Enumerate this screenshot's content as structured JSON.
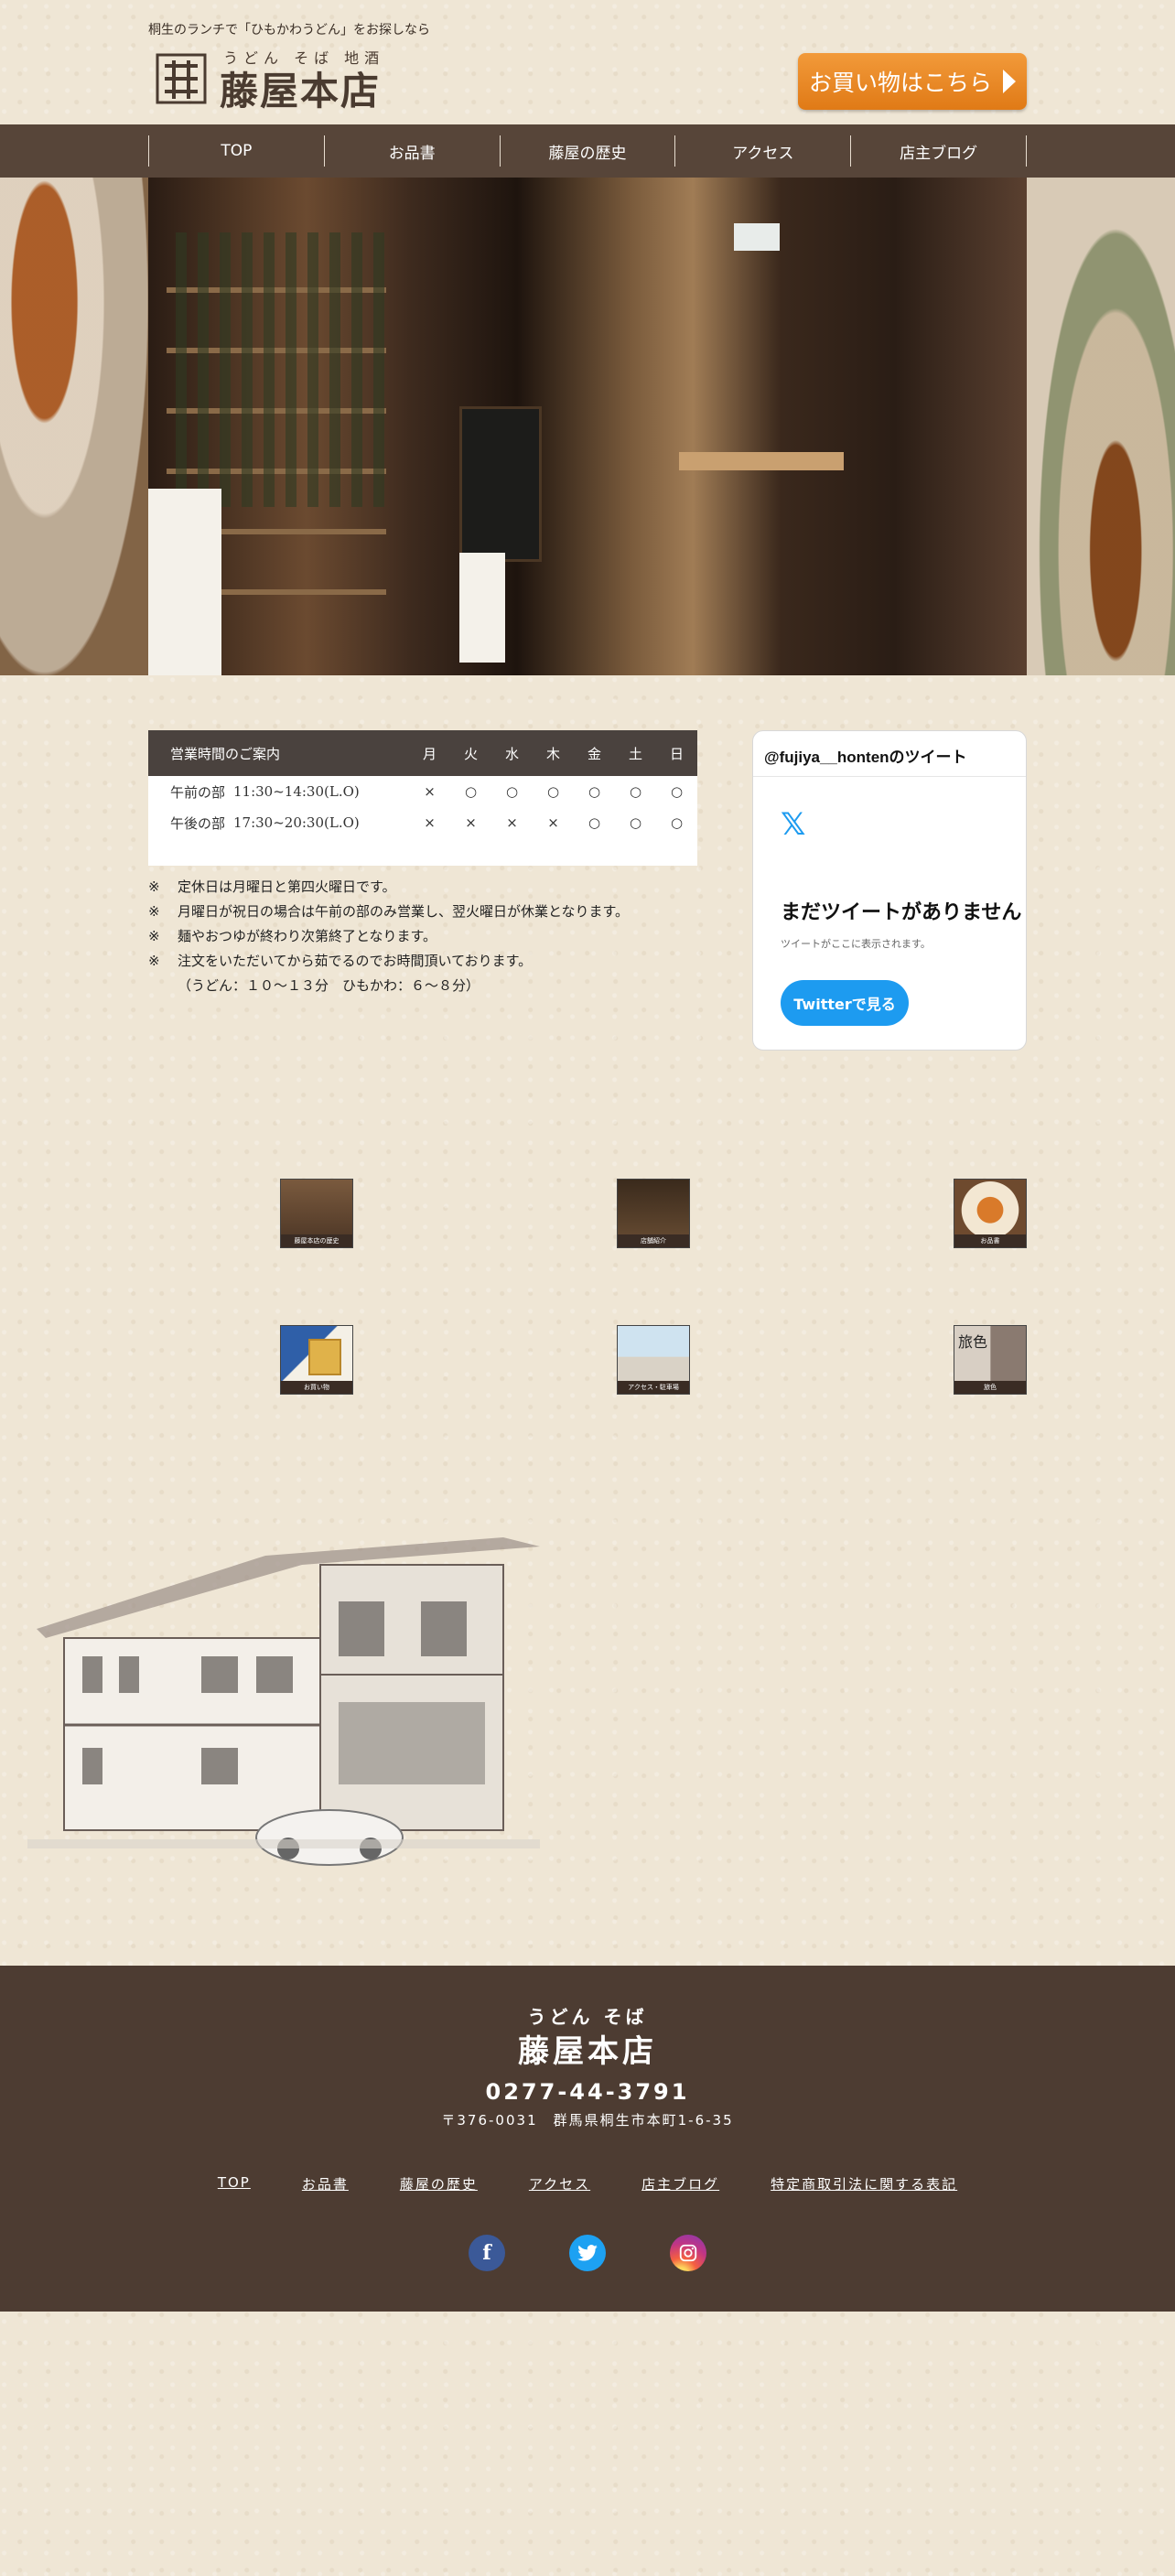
{
  "header": {
    "tagline": "桐生のランチで「ひもかわうどん」をお探しなら",
    "logo_sub": "うどん そば 地酒",
    "logo_name": "藤屋本店",
    "shop_button": "お買い物はこちら"
  },
  "nav": {
    "items": [
      {
        "label": "TOP"
      },
      {
        "label": "お品書"
      },
      {
        "label": "藤屋の歴史"
      },
      {
        "label": "アクセス"
      },
      {
        "label": "店主ブログ"
      }
    ]
  },
  "hours": {
    "title": "営業時間のご案内",
    "days": [
      "月",
      "火",
      "水",
      "木",
      "金",
      "土",
      "日"
    ],
    "rows": [
      {
        "label": "午前の部",
        "time": "11:30~14:30(L.O)",
        "marks": [
          "×",
          "○",
          "○",
          "○",
          "○",
          "○",
          "○"
        ]
      },
      {
        "label": "午後の部",
        "time": "17:30~20:30(L.O)",
        "marks": [
          "×",
          "×",
          "×",
          "×",
          "○",
          "○",
          "○"
        ]
      }
    ],
    "notes": [
      {
        "mark": "※",
        "text": "定休日は月曜日と第四火曜日です。"
      },
      {
        "mark": "※",
        "text": "月曜日が祝日の場合は午前の部のみ営業し、翌火曜日が休業となります。"
      },
      {
        "mark": "※",
        "text": "麺やおつゆが終わり次第終了となります。"
      },
      {
        "mark": "※",
        "text": "注文をいただいてから茹でるのでお時間頂いております。"
      },
      {
        "mark": "",
        "text": "（うどん：１０〜１３分　ひもかわ：６〜８分）"
      }
    ]
  },
  "twitter": {
    "handle": "@fujiya__hontenのツイート",
    "icon": "x-logo-icon",
    "heading": "まだツイートがありません",
    "sub": "ツイートがここに表示されます。",
    "button": "Twitterで見る"
  },
  "banners": [
    {
      "caption": "藤屋本店の歴史"
    },
    {
      "caption": "店舗紹介"
    },
    {
      "caption": "お品書"
    },
    {
      "caption": "お買い物"
    },
    {
      "caption": "アクセス・駐車場"
    },
    {
      "caption": "旅色",
      "title": "旅色"
    }
  ],
  "footer": {
    "sub": "うどん そば",
    "name": "藤屋本店",
    "tel": "0277-44-3791",
    "address": "〒376-0031　群馬県桐生市本町1-6-35",
    "links": [
      {
        "label": "TOP"
      },
      {
        "label": "お品書"
      },
      {
        "label": "藤屋の歴史"
      },
      {
        "label": "アクセス"
      },
      {
        "label": "店主ブログ"
      },
      {
        "label": "特定商取引法に関する表記"
      }
    ],
    "sns": [
      {
        "icon": "facebook-icon",
        "glyph": "f"
      },
      {
        "icon": "twitter-icon",
        "glyph": ""
      },
      {
        "icon": "instagram-icon",
        "glyph": ""
      }
    ]
  },
  "colors": {
    "nav_bg": "#574539",
    "accent_orange": "#e9861f",
    "footer_bg": "#4d3c32",
    "twitter_blue": "#1d9bf0"
  }
}
